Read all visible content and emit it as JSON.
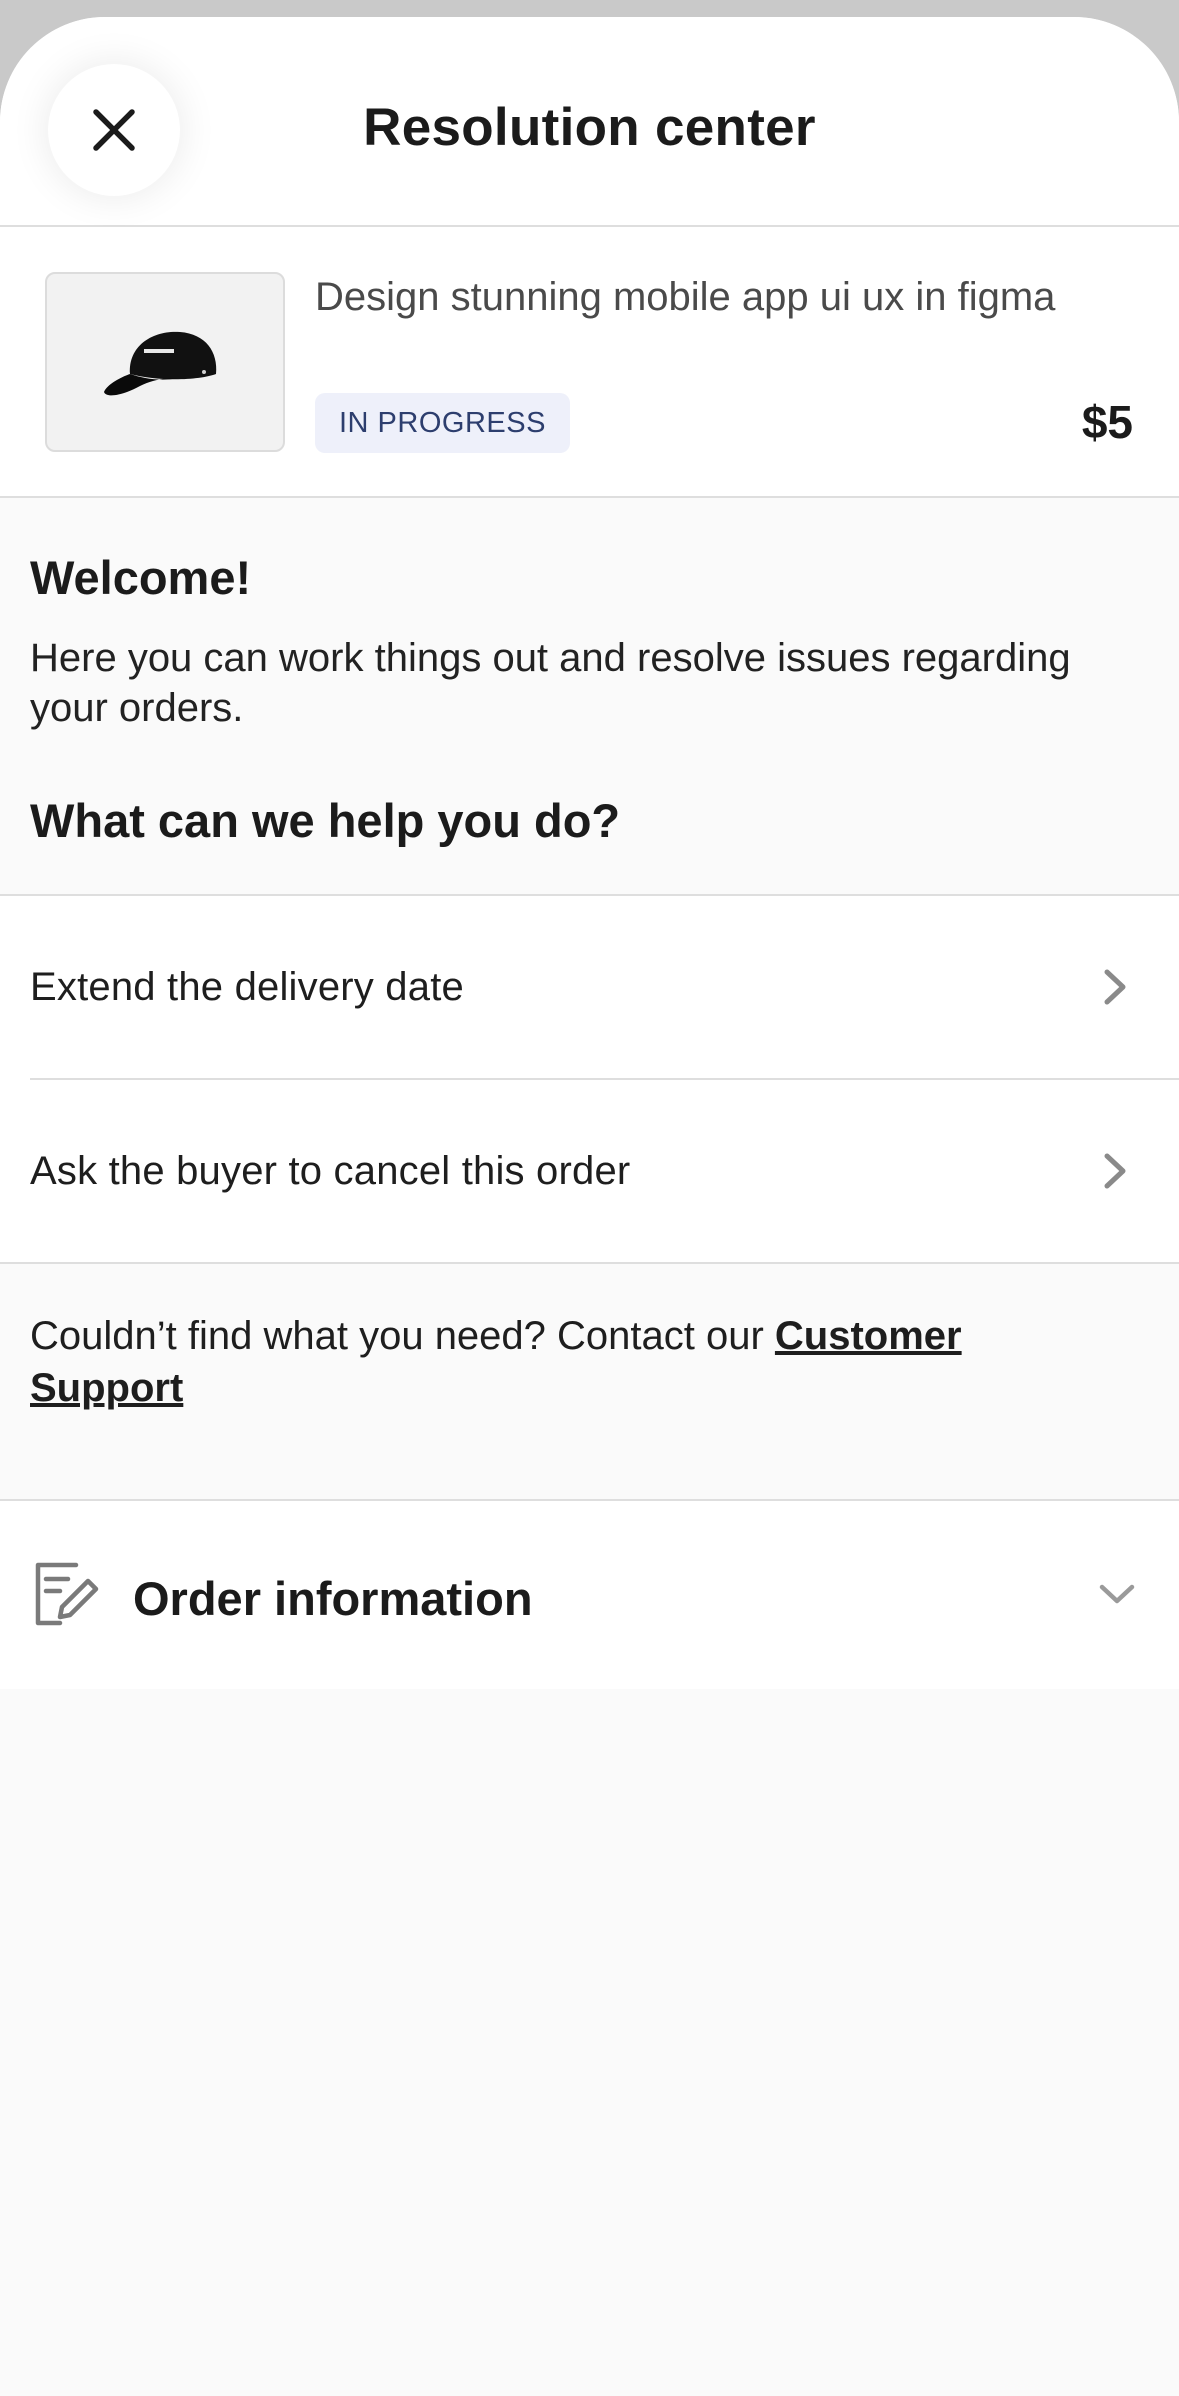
{
  "header": {
    "title": "Resolution center",
    "close_icon": "close-icon"
  },
  "order": {
    "title": "Design stunning mobile app ui ux in figma",
    "status": "IN PROGRESS",
    "price": "$5",
    "thumbnail_icon": "cap-image"
  },
  "welcome": {
    "heading": "Welcome!",
    "text": "Here you can work things out and resolve issues regarding your orders.",
    "help_heading": "What can we help you do?"
  },
  "options": [
    {
      "label": "Extend the delivery date",
      "icon": "chevron-right-icon"
    },
    {
      "label": "Ask the buyer to cancel this order",
      "icon": "chevron-right-icon"
    }
  ],
  "contact": {
    "text": "Couldn’t find what you need? Contact our ",
    "link": "Customer Support"
  },
  "order_info": {
    "label": "Order information",
    "icon": "document-edit-icon",
    "chevron": "chevron-down-icon"
  },
  "colors": {
    "badge_bg": "#eef0fa",
    "badge_text": "#2d3e6e",
    "background": "#fafafa"
  }
}
